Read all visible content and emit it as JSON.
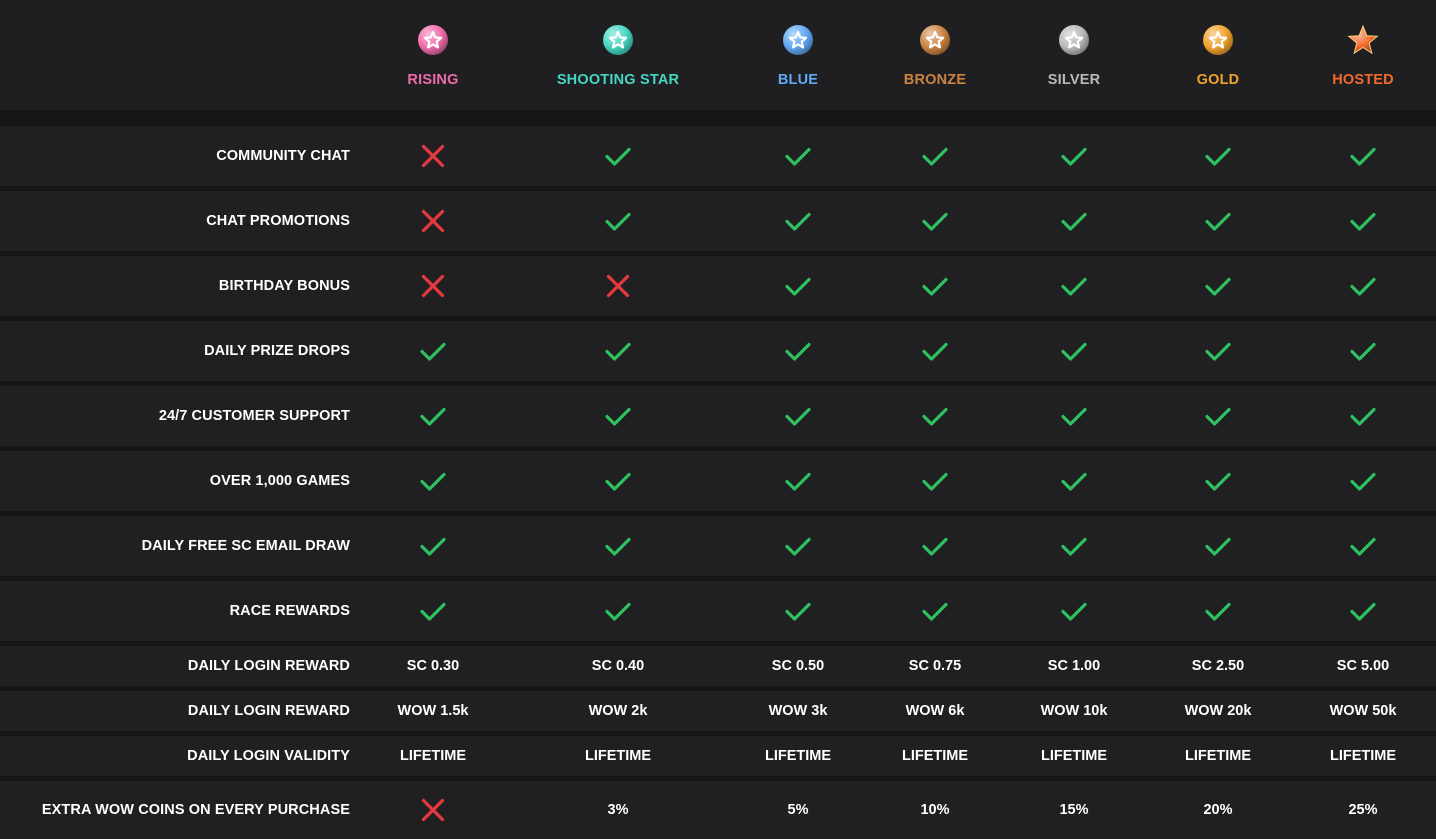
{
  "colors": {
    "background": "#151517",
    "row": "#202023",
    "check": "#2fc05f",
    "cross": "#e5393c"
  },
  "tiers": [
    {
      "name": "RISING",
      "color": "#f06aa8",
      "icon": "rising-star-badge-icon"
    },
    {
      "name": "SHOOTING STAR",
      "color": "#45d6c2",
      "icon": "shooting-star-badge-icon"
    },
    {
      "name": "BLUE",
      "color": "#5fa8f2",
      "icon": "blue-star-badge-icon"
    },
    {
      "name": "BRONZE",
      "color": "#c98442",
      "icon": "bronze-star-badge-icon"
    },
    {
      "name": "SILVER",
      "color": "#b9b9b9",
      "icon": "silver-star-badge-icon"
    },
    {
      "name": "GOLD",
      "color": "#f0a22c",
      "icon": "gold-star-badge-icon"
    },
    {
      "name": "HOSTED",
      "color": "#f26a2b",
      "icon": "hosted-star-badge-icon"
    }
  ],
  "features": [
    {
      "label": "COMMUNITY CHAT",
      "values": [
        "cross",
        "check",
        "check",
        "check",
        "check",
        "check",
        "check"
      ]
    },
    {
      "label": "CHAT PROMOTIONS",
      "values": [
        "cross",
        "check",
        "check",
        "check",
        "check",
        "check",
        "check"
      ]
    },
    {
      "label": "BIRTHDAY BONUS",
      "values": [
        "cross",
        "cross",
        "check",
        "check",
        "check",
        "check",
        "check"
      ]
    },
    {
      "label": "DAILY PRIZE DROPS",
      "values": [
        "check",
        "check",
        "check",
        "check",
        "check",
        "check",
        "check"
      ]
    },
    {
      "label": "24/7 CUSTOMER SUPPORT",
      "values": [
        "check",
        "check",
        "check",
        "check",
        "check",
        "check",
        "check"
      ]
    },
    {
      "label": "OVER 1,000 GAMES",
      "values": [
        "check",
        "check",
        "check",
        "check",
        "check",
        "check",
        "check"
      ]
    },
    {
      "label": "DAILY FREE SC EMAIL DRAW",
      "values": [
        "check",
        "check",
        "check",
        "check",
        "check",
        "check",
        "check"
      ]
    },
    {
      "label": "RACE REWARDS",
      "values": [
        "check",
        "check",
        "check",
        "check",
        "check",
        "check",
        "check"
      ]
    },
    {
      "label": "DAILY LOGIN REWARD",
      "values": [
        "SC 0.30",
        "SC 0.40",
        "SC 0.50",
        "SC 0.75",
        "SC 1.00",
        "SC 2.50",
        "SC 5.00"
      ]
    },
    {
      "label": "DAILY LOGIN REWARD",
      "values": [
        "WOW 1.5k",
        "WOW 2k",
        "WOW 3k",
        "WOW 6k",
        "WOW 10k",
        "WOW 20k",
        "WOW 50k"
      ]
    },
    {
      "label": "DAILY LOGIN VALIDITY",
      "values": [
        "LIFETIME",
        "LIFETIME",
        "LIFETIME",
        "LIFETIME",
        "LIFETIME",
        "LIFETIME",
        "LIFETIME"
      ]
    },
    {
      "label": "EXTRA WOW COINS ON EVERY PURCHASE",
      "values": [
        "cross",
        "3%",
        "5%",
        "10%",
        "15%",
        "20%",
        "25%"
      ]
    }
  ]
}
